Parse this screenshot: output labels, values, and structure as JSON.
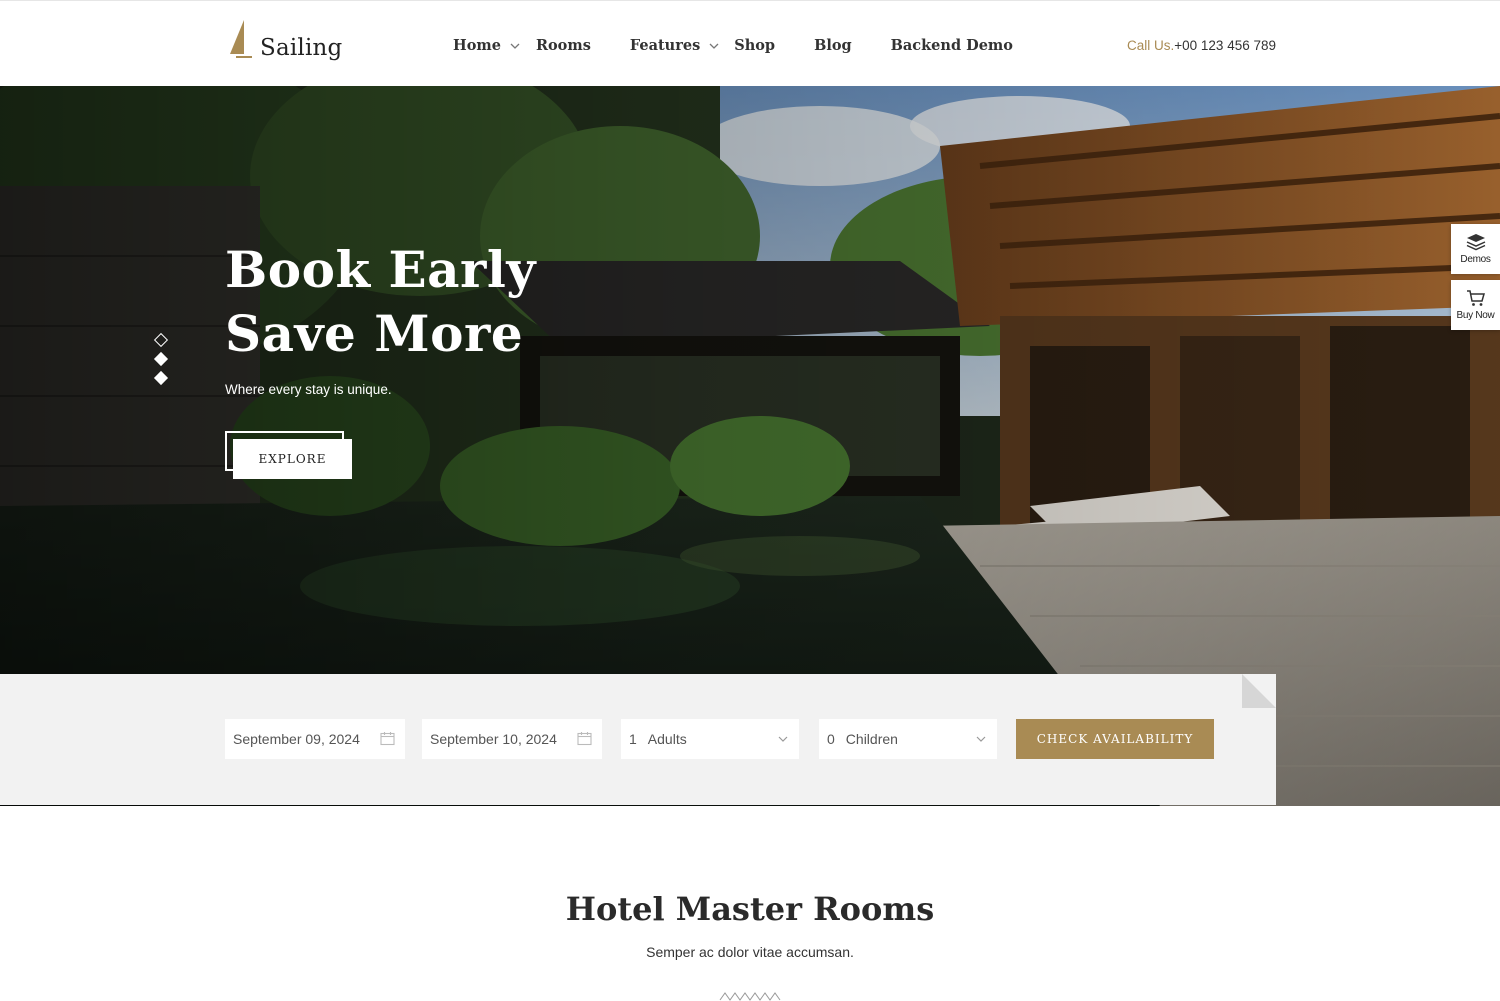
{
  "brand": {
    "name": "Sailing"
  },
  "nav": {
    "items": [
      {
        "label": "Home",
        "dropdown": true
      },
      {
        "label": "Rooms",
        "dropdown": false
      },
      {
        "label": "Features",
        "dropdown": true
      },
      {
        "label": "Shop",
        "dropdown": false
      },
      {
        "label": "Blog",
        "dropdown": false
      },
      {
        "label": "Backend Demo",
        "dropdown": false
      }
    ]
  },
  "contact": {
    "label": "Call Us.",
    "phone": "+00 123 456 789"
  },
  "hero": {
    "title": "Book Early\nSave More",
    "subtitle": "Where every stay is unique.",
    "cta": "EXPLORE",
    "slides_count": 3,
    "active_slide": 1
  },
  "side_widgets": {
    "demos": "Demos",
    "buy_now": "Buy Now"
  },
  "booking": {
    "check_in": "September 09, 2024",
    "check_out": "September 10, 2024",
    "adults_count": "1",
    "adults_label": "Adults",
    "children_count": "0",
    "children_label": "Children",
    "button": "CHECK AVAILABILITY"
  },
  "section": {
    "title": "Hotel Master Rooms",
    "subtitle": "Semper ac dolor vitae accumsan."
  },
  "colors": {
    "accent": "#a98b54",
    "booking_bg": "#f2f2f2",
    "text": "#222222"
  },
  "icons": [
    "logo-sail-icon",
    "chevron-down-icon",
    "layers-icon",
    "cart-icon",
    "calendar-icon",
    "zigzag-divider-icon"
  ]
}
